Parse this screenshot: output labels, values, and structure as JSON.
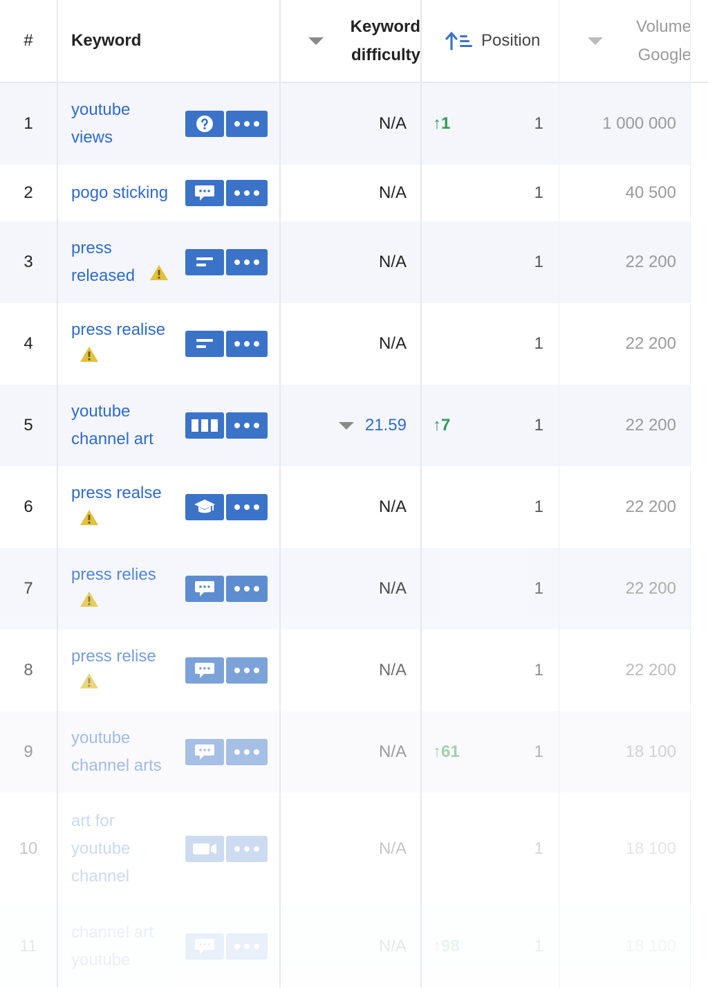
{
  "header": {
    "col_num": "#",
    "col_keyword": "Keyword",
    "col_kd_line1": "Keyword",
    "col_kd_line2": "difficulty",
    "col_position": "Position",
    "col_volume_line1": "Volume",
    "col_volume_line2": "Google"
  },
  "rows": [
    {
      "num": "1",
      "kw1": "youtube",
      "kw2": "views",
      "kw3": "",
      "warn": false,
      "intent": "question-icon",
      "kd": "N/A",
      "kd_caret": false,
      "change": "↑1",
      "position": "1",
      "volume": "1 000 000",
      "opacity": 1
    },
    {
      "num": "2",
      "kw1": "pogo sticking",
      "kw2": "",
      "kw3": "",
      "warn": false,
      "intent": "chat-icon",
      "kd": "N/A",
      "kd_caret": false,
      "change": "",
      "position": "1",
      "volume": "40 500",
      "opacity": 1
    },
    {
      "num": "3",
      "kw1": "press",
      "kw2": "released",
      "kw3": "",
      "warn": true,
      "intent": "text-lines-icon",
      "kd": "N/A",
      "kd_caret": false,
      "change": "",
      "position": "1",
      "volume": "22 200",
      "opacity": 1
    },
    {
      "num": "4",
      "kw1": "press realise",
      "kw2": "",
      "kw3": "",
      "warn": true,
      "intent": "text-lines-icon",
      "kd": "N/A",
      "kd_caret": false,
      "change": "",
      "position": "1",
      "volume": "22 200",
      "opacity": 1
    },
    {
      "num": "5",
      "kw1": "youtube",
      "kw2": "channel art",
      "kw3": "",
      "warn": false,
      "intent": "columns-icon",
      "kd": "21.59",
      "kd_caret": true,
      "change": "↑7",
      "position": "1",
      "volume": "22 200",
      "opacity": 1
    },
    {
      "num": "6",
      "kw1": "press realse",
      "kw2": "",
      "kw3": "",
      "warn": true,
      "intent": "graduation-cap-icon",
      "kd": "N/A",
      "kd_caret": false,
      "change": "",
      "position": "1",
      "volume": "22 200",
      "opacity": 1
    },
    {
      "num": "7",
      "kw1": "press relies",
      "kw2": "",
      "kw3": "",
      "warn": true,
      "intent": "chat-icon",
      "kd": "N/A",
      "kd_caret": false,
      "change": "",
      "position": "1",
      "volume": "22 200",
      "opacity": 0.82
    },
    {
      "num": "8",
      "kw1": "press relise",
      "kw2": "",
      "kw3": "",
      "warn": true,
      "intent": "chat-icon",
      "kd": "N/A",
      "kd_caret": false,
      "change": "",
      "position": "1",
      "volume": "22 200",
      "opacity": 0.66
    },
    {
      "num": "9",
      "kw1": "youtube",
      "kw2": "channel arts",
      "kw3": "",
      "warn": false,
      "intent": "chat-icon",
      "kd": "N/A",
      "kd_caret": false,
      "change": "↑61",
      "position": "1",
      "volume": "18 100",
      "opacity": 0.45
    },
    {
      "num": "10",
      "kw1": "art for",
      "kw2": "youtube",
      "kw3": "channel",
      "warn": false,
      "intent": "video-camera-icon",
      "kd": "N/A",
      "kd_caret": false,
      "change": "",
      "position": "1",
      "volume": "18 100",
      "opacity": 0.25
    },
    {
      "num": "11",
      "kw1": "channel art",
      "kw2": "youtube",
      "kw3": "",
      "warn": false,
      "intent": "chat-icon",
      "kd": "N/A",
      "kd_caret": false,
      "change": "↑98",
      "position": "1",
      "volume": "18 100",
      "opacity": 0.1
    }
  ],
  "colors": {
    "accent_blue": "#3a73c7",
    "link_blue": "#2f6bc9",
    "up_green": "#2f9a57",
    "warning_yellow": "#e2c13c"
  }
}
